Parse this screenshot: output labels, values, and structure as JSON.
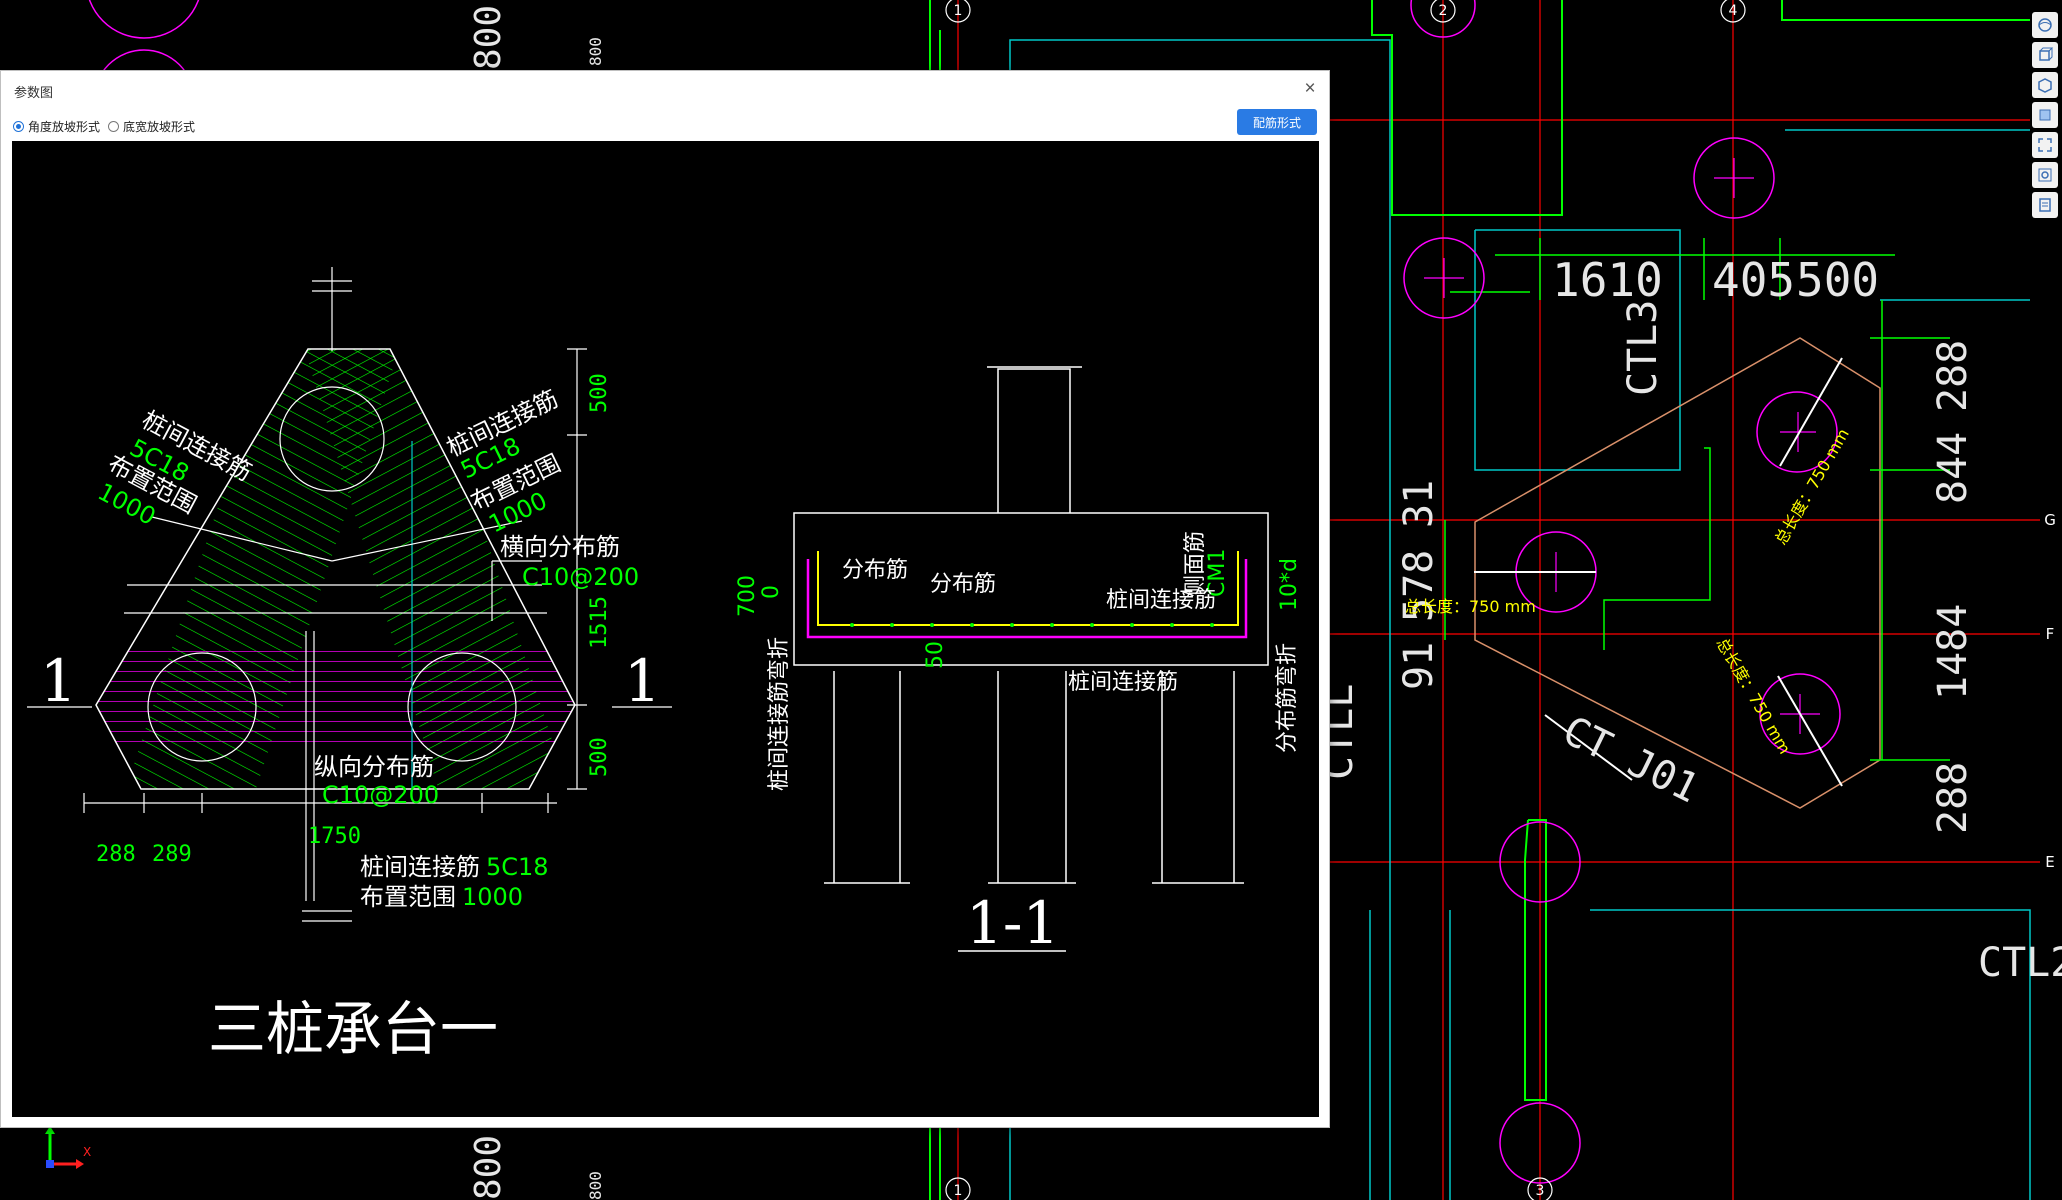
{
  "cad": {
    "dims_top": [
      "1610",
      "405",
      "500"
    ],
    "dims_right": [
      "288",
      "844",
      "1484",
      "288"
    ],
    "dims_left": [
      "31",
      "578",
      "91"
    ],
    "labels": [
      "CTL3",
      "CT J01",
      "CTL2",
      "CTLL",
      "800",
      "800",
      "800",
      "800"
    ],
    "grid_bubbles": [
      "1",
      "2",
      "4",
      "1",
      "3"
    ],
    "axis_marks": [
      "G",
      "F",
      "E"
    ],
    "length_labels": [
      "总长度：750 mm",
      "总长度：750 mm",
      "总长度：750 mm"
    ],
    "axis_x_label": "X"
  },
  "dialog": {
    "title": "参数图",
    "close": "×",
    "options": [
      {
        "label": "角度放坡形式",
        "selected": true
      },
      {
        "label": "底宽放坡形式",
        "selected": false
      }
    ],
    "button": "配筋形式"
  },
  "drawing": {
    "left_title": "三桩承台一",
    "right_title": "1-1",
    "section_marks": [
      "1",
      "1"
    ],
    "plan_texts": [
      "桩间连接筋",
      "5C18",
      "布置范围",
      "1000",
      "桩间连接筋",
      "5C18",
      "布置范围",
      "1000",
      "横向分布筋",
      "C10@200",
      "纵向分布筋",
      "C10@200",
      "桩间连接筋",
      "5C18",
      "布置范围",
      "1000"
    ],
    "plan_dims": [
      "500",
      "1515",
      "500",
      "1750",
      "288",
      "289"
    ],
    "section_texts": [
      "分布筋",
      "分布筋",
      "侧面筋",
      "CM1",
      "桩间连接筋",
      "桩间连接筋",
      "10*d",
      "分布筋弯折",
      "桩间连接筋弯折",
      "700",
      "0",
      "50"
    ]
  },
  "colors": {
    "cad_bg": "#000000",
    "grid_red": "#ff0000",
    "cad_green": "#00ff00",
    "cad_cyan": "#00c8c8",
    "cad_magenta": "#ff00ff",
    "label_yellow": "#ffff00",
    "accent_blue": "#2a7be4"
  },
  "toolbar_icons": [
    "3d-view-icon",
    "view-cube-icon",
    "box-icon",
    "layer-icon",
    "fullscreen-icon",
    "settings-icon",
    "report-icon"
  ]
}
